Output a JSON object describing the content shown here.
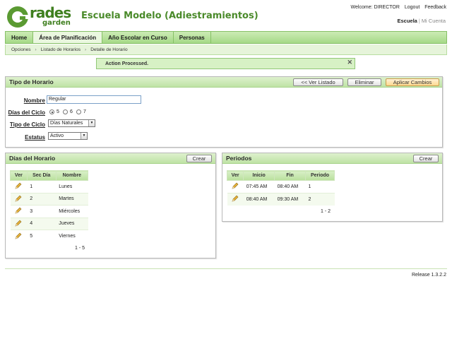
{
  "header": {
    "logo_text_main": "rades",
    "logo_text_sub": "garden",
    "site_title": "Escuela Modelo (Adiestramientos)",
    "welcome": "Welcome: DIRECTOR",
    "logout": "Logout",
    "feedback": "Feedback",
    "school_current": "Escuela",
    "school_sep": "|",
    "my_account": "Mi Cuenta"
  },
  "nav": {
    "tabs": [
      {
        "label": "Home"
      },
      {
        "label": "Área de Planificación"
      },
      {
        "label": "Año Escolar en Curso"
      },
      {
        "label": "Personas"
      }
    ],
    "active_index": 1
  },
  "breadcrumb": [
    "Opciones",
    "Listado de Horarios",
    "Detalle de Horario"
  ],
  "message": {
    "text": "Action Processed.",
    "close": "✕"
  },
  "tipo_horario": {
    "title": "Tipo de Horario",
    "buttons": {
      "ver_listado": "<< Ver Listado",
      "eliminar": "Eliminar",
      "aplicar": "Aplicar Cambios"
    },
    "fields": {
      "nombre_label": "Nombre",
      "nombre_value": "Regular",
      "dias_label": "Días del Ciclo",
      "dias_options": [
        "5",
        "6",
        "7"
      ],
      "dias_selected": "5",
      "tipo_label": "Tipo de Ciclo",
      "tipo_value": "Días Naturales",
      "estatus_label": "Estatus",
      "estatus_value": "Activo"
    }
  },
  "dias_horario": {
    "title": "Días del Horario",
    "crear": "Crear",
    "columns": [
      "Ver",
      "Sec Día",
      "Nombre"
    ],
    "rows": [
      {
        "sec": "1",
        "nombre": "Lunes"
      },
      {
        "sec": "2",
        "nombre": "Martes"
      },
      {
        "sec": "3",
        "nombre": "Miércoles"
      },
      {
        "sec": "4",
        "nombre": "Jueves"
      },
      {
        "sec": "5",
        "nombre": "Viernes"
      }
    ],
    "pager": "1 - 5"
  },
  "periodos": {
    "title": "Periodos",
    "crear": "Crear",
    "columns": [
      "Ver",
      "Inicio",
      "Fin",
      "Periodo"
    ],
    "rows": [
      {
        "inicio": "07:45 AM",
        "fin": "08:40 AM",
        "periodo": "1"
      },
      {
        "inicio": "08:40 AM",
        "fin": "09:30 AM",
        "periodo": "2"
      }
    ],
    "pager": "1 - 2"
  },
  "footer": {
    "release": "Release 1.3.2.2"
  },
  "colors": {
    "brand_green": "#4a8a2a",
    "nav_green": "#a5d987",
    "message_bg": "#d7f1c5",
    "apply_button": "#ffd98f"
  },
  "icons": [
    "grades-garden-logo",
    "pencil-icon",
    "close-icon",
    "chevron-right-icon",
    "dropdown-arrow-icon"
  ]
}
